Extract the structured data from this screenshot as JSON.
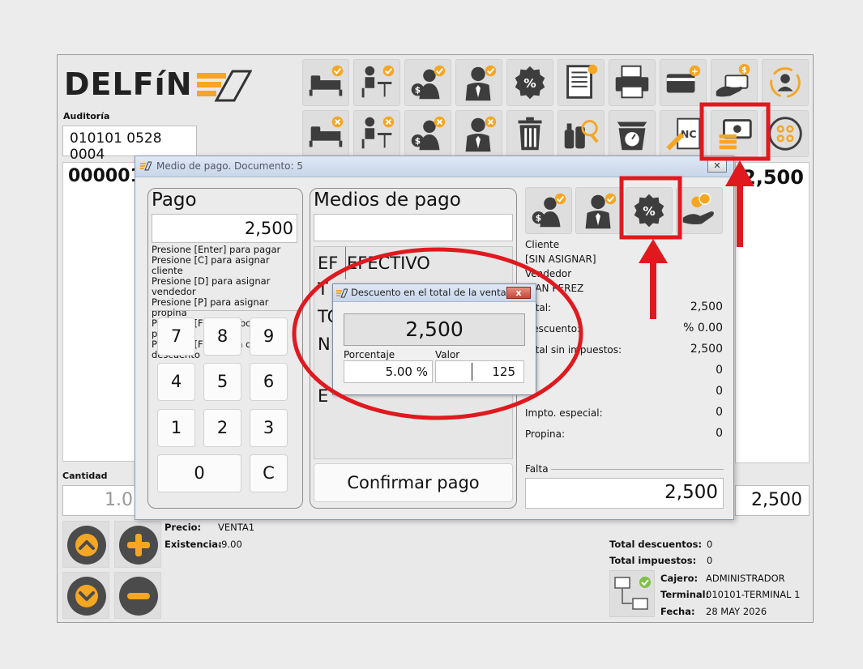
{
  "brand": {
    "logo_text": "DELFíN",
    "accent": "#f5a623",
    "dark": "#3d3d3d"
  },
  "left": {
    "audit_label": "Auditoría",
    "audit_value": "010101 0528 0004",
    "doc_number": "000001",
    "qty_label": "Cantidad",
    "qty_value": "1.0",
    "right_total": "2,500",
    "price_label": "Precio:",
    "price_value": "VENTA1",
    "stock_label": "Existencia:",
    "stock_value": "-9.00"
  },
  "toolbar_icons": [
    "bed-check-icon",
    "seated-customer-check-icon",
    "cashier-check-icon",
    "seller-check-icon",
    "discount-badge-icon",
    "document-list-icon",
    "printer-icon",
    "card-add-icon",
    "cash-hand-icon",
    "user-refresh-icon",
    "bed-cancel-icon",
    "seated-customer-cancel-icon",
    "cashier-cancel-icon",
    "seller-cancel-icon",
    "trash-icon",
    "bottles-search-icon",
    "scale-icon",
    "nc-note-icon",
    "payment-icon",
    "more-options-icon"
  ],
  "dialog": {
    "title": "Medio de pago. Documento: 5",
    "pago_title": "Pago",
    "pago_amount": "2,500",
    "hints": [
      "Presione [Enter] para pagar",
      "Presione [C] para asignar cliente",
      "Presione [D] para asignar vendedor",
      "Presione [P] para asignar propina",
      "Presione [F5] para borrar un pago",
      "Presione [F11] para dar descuento"
    ],
    "keypad": [
      "7",
      "8",
      "9",
      "4",
      "5",
      "6",
      "1",
      "2",
      "3",
      "0",
      "C"
    ],
    "medios_title": "Medios de pago",
    "medios_input": "",
    "medios_rows": [
      {
        "code": "EF",
        "name": "EFECTIVO"
      },
      {
        "code": "T",
        "name": ""
      },
      {
        "code": "TC",
        "name": ""
      },
      {
        "code": "N",
        "name": ""
      },
      {
        "code": "E",
        "name": ""
      }
    ],
    "confirm_label": "Confirmar pago",
    "cliente_label": "Cliente",
    "cliente_value": "[SIN ASIGNAR]",
    "vendedor_label": "Vendedor",
    "vendedor_value": "JUAN PEREZ",
    "summary": [
      {
        "label": "Total:",
        "value": "2,500"
      },
      {
        "label": "Descuento:",
        "value": "%  0.00"
      },
      {
        "label": "Total sin impuestos:",
        "value": "2,500"
      },
      {
        "label": "",
        "value": "0"
      },
      {
        "label": "",
        "value": "0"
      },
      {
        "label": "Impto. especial:",
        "value": "0"
      },
      {
        "label": "Propina:",
        "value": "0"
      }
    ],
    "falta_label": "Falta",
    "falta_value": "2,500"
  },
  "popup": {
    "title": "Descuento en el total de la venta",
    "close_label": "x",
    "amount": "2,500",
    "pct_label": "Porcentaje",
    "pct_value": "5.00 %",
    "val_label": "Valor",
    "val_value": "125"
  },
  "footer": {
    "total_desc_label": "Total descuentos:",
    "total_desc_value": "0",
    "total_imp_label": "Total impuestos:",
    "total_imp_value": "0",
    "cajero_label": "Cajero:",
    "cajero_value": "ADMINISTRADOR",
    "terminal_label": "Terminal:",
    "terminal_value": "010101-TERMINAL 1",
    "fecha_label": "Fecha:",
    "fecha_value": "28 MAY 2026"
  },
  "annotations": {
    "color": "#e0191f"
  }
}
